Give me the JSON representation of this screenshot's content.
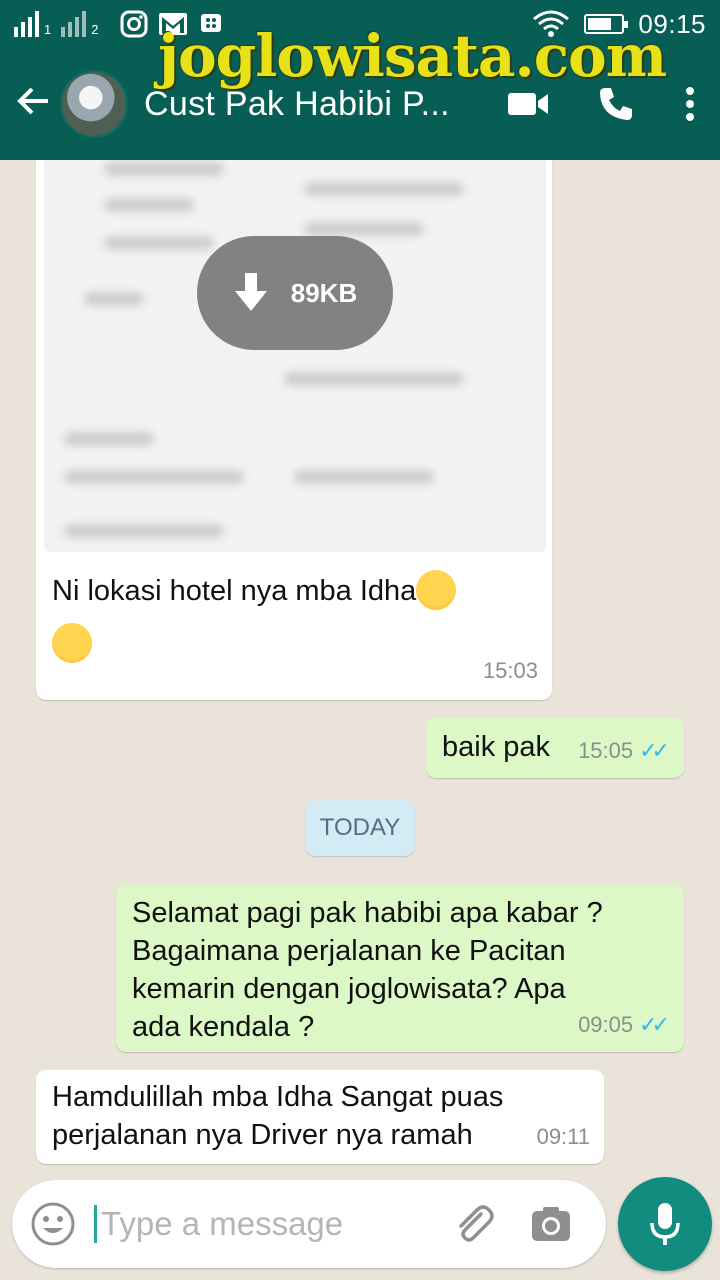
{
  "watermark": "joglowisata.com",
  "statusbar": {
    "sim1": "1",
    "sim2": "2",
    "time": "09:15",
    "battery_level": 0.75
  },
  "header": {
    "contact_name": "Cust Pak Habibi P...",
    "icons": [
      "back-arrow-icon",
      "video-call-icon",
      "phone-icon",
      "more-vert-icon"
    ]
  },
  "messages": [
    {
      "direction": "in",
      "type": "document",
      "file_size": "89KB",
      "caption": "Ni lokasi hotel nya mba Idha",
      "time": "15:03"
    },
    {
      "direction": "out",
      "text": "baik pak",
      "time": "15:05",
      "status": "read"
    },
    {
      "direction": "in",
      "text": "Hamdulillah mba Idha Sangat puas perjalanan nya Driver nya ramah",
      "time": "09:11"
    }
  ],
  "date_divider": "TODAY",
  "out_message_2": {
    "line1": "Selamat pagi pak habibi apa kabar ?",
    "line2": "Bagaimana perjalanan ke Pacitan",
    "line3": "kemarin dengan joglowisata? Apa",
    "line4": "ada kendala ?",
    "time": "09:05"
  },
  "in_message_2": {
    "line1": "Hamdulillah mba Idha Sangat puas",
    "line2": "perjalanan nya Driver nya ramah",
    "time": "09:11"
  },
  "composer": {
    "placeholder": "Type a message",
    "icons": [
      "emoji-icon",
      "attach-icon",
      "camera-icon",
      "mic-icon"
    ]
  },
  "colors": {
    "header": "#075e54",
    "outgoing_bubble": "#dcf8c6",
    "incoming_bubble": "#ffffff",
    "read_ticks": "#34b7f1",
    "mic_button": "#128c7e",
    "watermark": "#e7e11a"
  }
}
